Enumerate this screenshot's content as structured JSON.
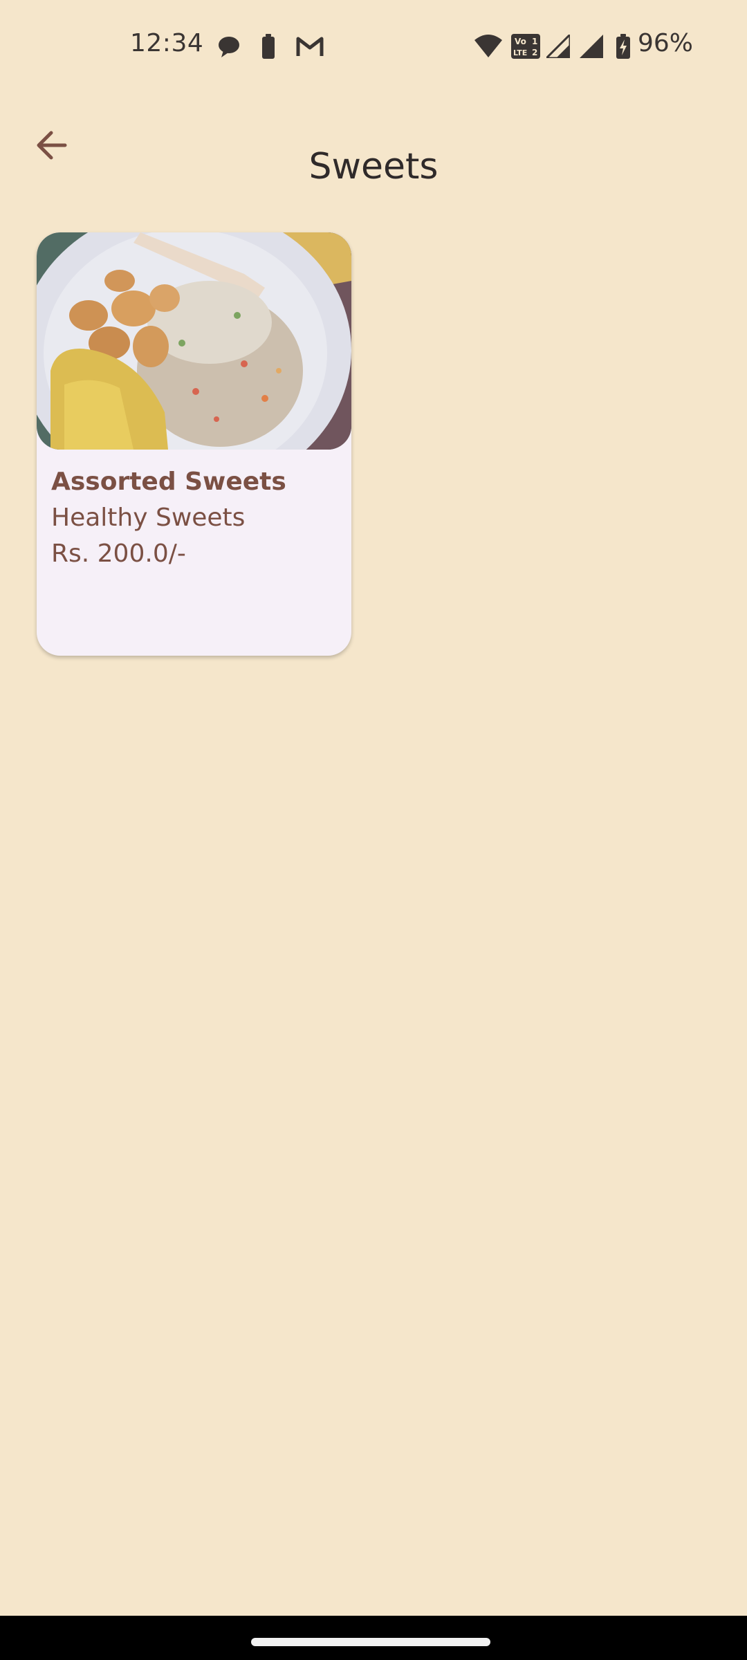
{
  "status_bar": {
    "time": "12:34",
    "battery_percent": "96%",
    "icons": [
      "chat-bubble-icon",
      "battery-saver-icon",
      "gmail-icon",
      "wifi-icon",
      "volte-icon",
      "signal-1-icon",
      "signal-2-icon",
      "battery-charging-icon"
    ],
    "volte_label_top": "Vo",
    "volte_label_bottom": "LTE",
    "volte_sim1": "1",
    "volte_sim2": "2"
  },
  "app_bar": {
    "title": "Sweets",
    "back_icon": "arrow-back-icon"
  },
  "products": [
    {
      "name": "Assorted Sweets",
      "description": "Healthy Sweets",
      "price": "Rs. 200.0/-"
    }
  ],
  "colors": {
    "background": "#f5e6cb",
    "card_background": "#f6f0f8",
    "accent_text": "#7b5044",
    "title_text": "#2f2a2a",
    "nav_bar": "#000000"
  }
}
